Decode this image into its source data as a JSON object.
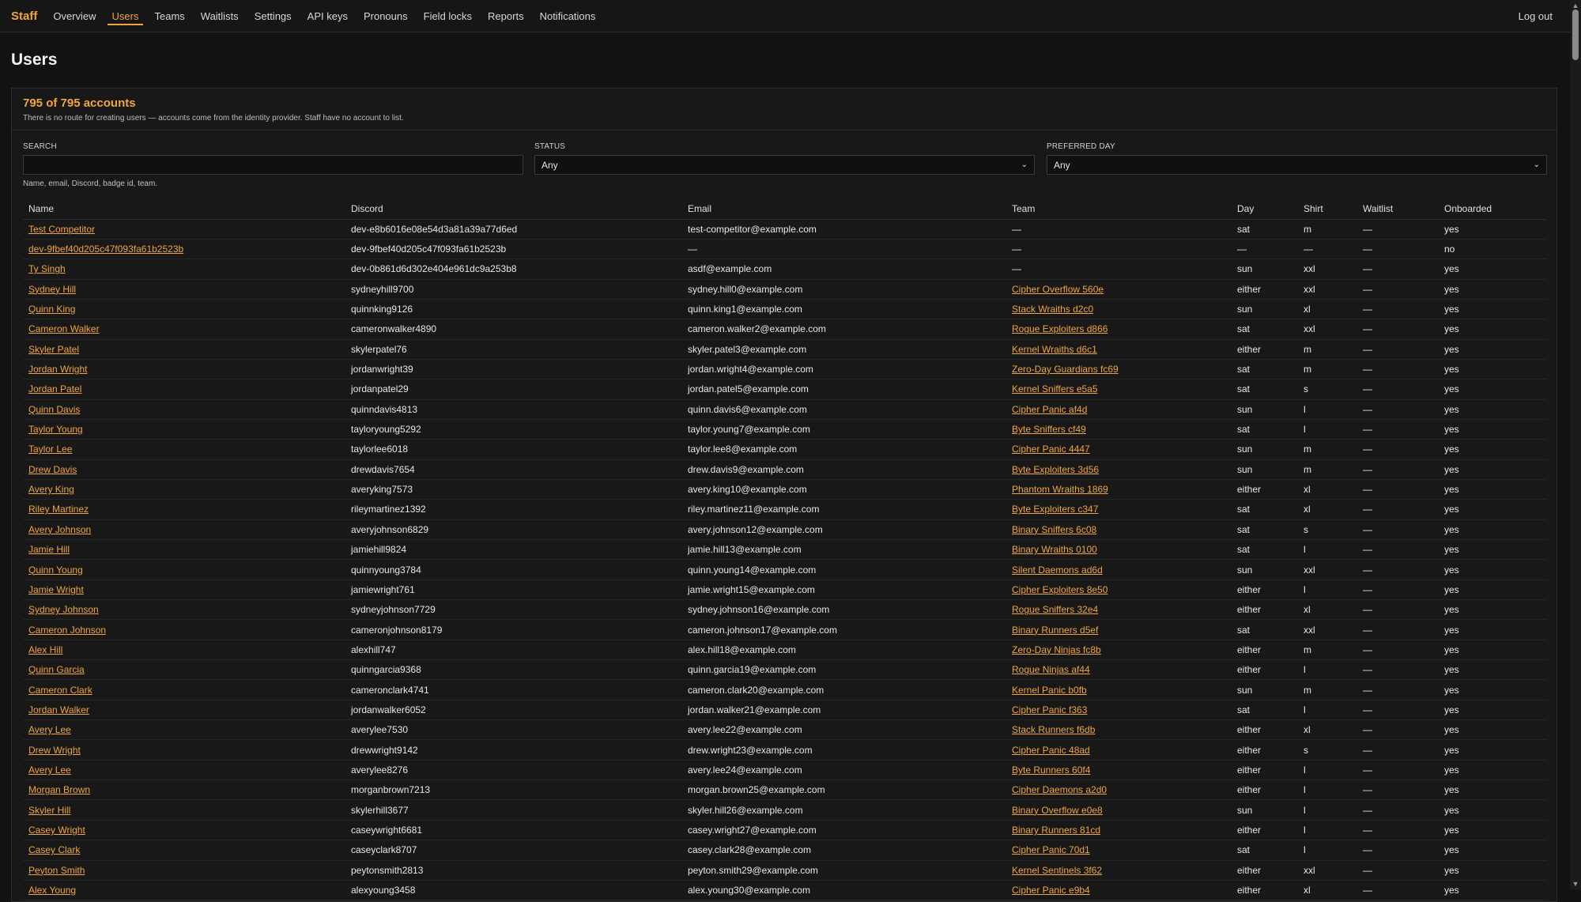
{
  "brand": "Staff",
  "nav": [
    "Overview",
    "Users",
    "Teams",
    "Waitlists",
    "Settings",
    "API keys",
    "Pronouns",
    "Field locks",
    "Reports",
    "Notifications"
  ],
  "active_nav": "Users",
  "logout": "Log out",
  "page_title": "Users",
  "summary": {
    "count": "795 of 795 accounts",
    "note": "There is no route for creating users — accounts come from the identity provider. Staff have no account to list."
  },
  "filters": {
    "search_label": "SEARCH",
    "search_value": "",
    "search_help": "Name, email, Discord, badge id, team.",
    "status_label": "STATUS",
    "status_value": "Any",
    "day_label": "PREFERRED DAY",
    "day_value": "Any"
  },
  "columns": [
    "Name",
    "Discord",
    "Email",
    "Team",
    "Day",
    "Shirt",
    "Waitlist",
    "Onboarded"
  ],
  "rows": [
    [
      "Test Competitor",
      "dev-e8b6016e08e54d3a81a39a77d6ed",
      "test-competitor@example.com",
      "—",
      "sat",
      "m",
      "—",
      "yes"
    ],
    [
      "dev-9fbef40d205c47f093fa61b2523b",
      "dev-9fbef40d205c47f093fa61b2523b",
      "—",
      "—",
      "—",
      "—",
      "—",
      "no"
    ],
    [
      "Ty Singh",
      "dev-0b861d6d302e404e961dc9a253b8",
      "asdf@example.com",
      "—",
      "sun",
      "xxl",
      "—",
      "yes"
    ],
    [
      "Sydney Hill",
      "sydneyhill9700",
      "sydney.hill0@example.com",
      "Cipher Overflow 560e",
      "either",
      "xxl",
      "—",
      "yes"
    ],
    [
      "Quinn King",
      "quinnking9126",
      "quinn.king1@example.com",
      "Stack Wraiths d2c0",
      "sun",
      "xl",
      "—",
      "yes"
    ],
    [
      "Cameron Walker",
      "cameronwalker4890",
      "cameron.walker2@example.com",
      "Rogue Exploiters d866",
      "sat",
      "xxl",
      "—",
      "yes"
    ],
    [
      "Skyler Patel",
      "skylerpatel76",
      "skyler.patel3@example.com",
      "Kernel Wraiths d6c1",
      "either",
      "m",
      "—",
      "yes"
    ],
    [
      "Jordan Wright",
      "jordanwright39",
      "jordan.wright4@example.com",
      "Zero-Day Guardians fc69",
      "sat",
      "m",
      "—",
      "yes"
    ],
    [
      "Jordan Patel",
      "jordanpatel29",
      "jordan.patel5@example.com",
      "Kernel Sniffers e5a5",
      "sat",
      "s",
      "—",
      "yes"
    ],
    [
      "Quinn Davis",
      "quinndavis4813",
      "quinn.davis6@example.com",
      "Cipher Panic af4d",
      "sun",
      "l",
      "—",
      "yes"
    ],
    [
      "Taylor Young",
      "tayloryoung5292",
      "taylor.young7@example.com",
      "Byte Sniffers cf49",
      "sat",
      "l",
      "—",
      "yes"
    ],
    [
      "Taylor Lee",
      "taylorlee6018",
      "taylor.lee8@example.com",
      "Cipher Panic 4447",
      "sun",
      "m",
      "—",
      "yes"
    ],
    [
      "Drew Davis",
      "drewdavis7654",
      "drew.davis9@example.com",
      "Byte Exploiters 3d56",
      "sun",
      "m",
      "—",
      "yes"
    ],
    [
      "Avery King",
      "averyking7573",
      "avery.king10@example.com",
      "Phantom Wraiths 1869",
      "either",
      "xl",
      "—",
      "yes"
    ],
    [
      "Riley Martinez",
      "rileymartinez1392",
      "riley.martinez11@example.com",
      "Byte Exploiters c347",
      "sat",
      "xl",
      "—",
      "yes"
    ],
    [
      "Avery Johnson",
      "averyjohnson6829",
      "avery.johnson12@example.com",
      "Binary Sniffers 6c08",
      "sat",
      "s",
      "—",
      "yes"
    ],
    [
      "Jamie Hill",
      "jamiehill9824",
      "jamie.hill13@example.com",
      "Binary Wraiths 0100",
      "sat",
      "l",
      "—",
      "yes"
    ],
    [
      "Quinn Young",
      "quinnyoung3784",
      "quinn.young14@example.com",
      "Silent Daemons ad6d",
      "sun",
      "xxl",
      "—",
      "yes"
    ],
    [
      "Jamie Wright",
      "jamiewright761",
      "jamie.wright15@example.com",
      "Cipher Exploiters 8e50",
      "either",
      "l",
      "—",
      "yes"
    ],
    [
      "Sydney Johnson",
      "sydneyjohnson7729",
      "sydney.johnson16@example.com",
      "Rogue Sniffers 32e4",
      "either",
      "xl",
      "—",
      "yes"
    ],
    [
      "Cameron Johnson",
      "cameronjohnson8179",
      "cameron.johnson17@example.com",
      "Binary Runners d5ef",
      "sat",
      "xxl",
      "—",
      "yes"
    ],
    [
      "Alex Hill",
      "alexhill747",
      "alex.hill18@example.com",
      "Zero-Day Ninjas fc8b",
      "either",
      "m",
      "—",
      "yes"
    ],
    [
      "Quinn Garcia",
      "quinngarcia9368",
      "quinn.garcia19@example.com",
      "Rogue Ninjas af44",
      "either",
      "l",
      "—",
      "yes"
    ],
    [
      "Cameron Clark",
      "cameronclark4741",
      "cameron.clark20@example.com",
      "Kernel Panic b0fb",
      "sun",
      "m",
      "—",
      "yes"
    ],
    [
      "Jordan Walker",
      "jordanwalker6052",
      "jordan.walker21@example.com",
      "Cipher Panic f363",
      "sat",
      "l",
      "—",
      "yes"
    ],
    [
      "Avery Lee",
      "averylee7530",
      "avery.lee22@example.com",
      "Stack Runners f6db",
      "either",
      "xl",
      "—",
      "yes"
    ],
    [
      "Drew Wright",
      "drewwright9142",
      "drew.wright23@example.com",
      "Cipher Panic 48ad",
      "either",
      "s",
      "—",
      "yes"
    ],
    [
      "Avery Lee",
      "averylee8276",
      "avery.lee24@example.com",
      "Byte Runners 60f4",
      "either",
      "l",
      "—",
      "yes"
    ],
    [
      "Morgan Brown",
      "morganbrown7213",
      "morgan.brown25@example.com",
      "Cipher Daemons a2d0",
      "either",
      "l",
      "—",
      "yes"
    ],
    [
      "Skyler Hill",
      "skylerhill3677",
      "skyler.hill26@example.com",
      "Binary Overflow e0e8",
      "sun",
      "l",
      "—",
      "yes"
    ],
    [
      "Casey Wright",
      "caseywright6681",
      "casey.wright27@example.com",
      "Binary Runners 81cd",
      "either",
      "l",
      "—",
      "yes"
    ],
    [
      "Casey Clark",
      "caseyclark8707",
      "casey.clark28@example.com",
      "Cipher Panic 70d1",
      "sat",
      "l",
      "—",
      "yes"
    ],
    [
      "Peyton Smith",
      "peytonsmith2813",
      "peyton.smith29@example.com",
      "Kernel Sentinels 3f62",
      "either",
      "xxl",
      "—",
      "yes"
    ],
    [
      "Alex Young",
      "alexyoung3458",
      "alex.young30@example.com",
      "Cipher Panic e9b4",
      "either",
      "xl",
      "—",
      "yes"
    ]
  ]
}
